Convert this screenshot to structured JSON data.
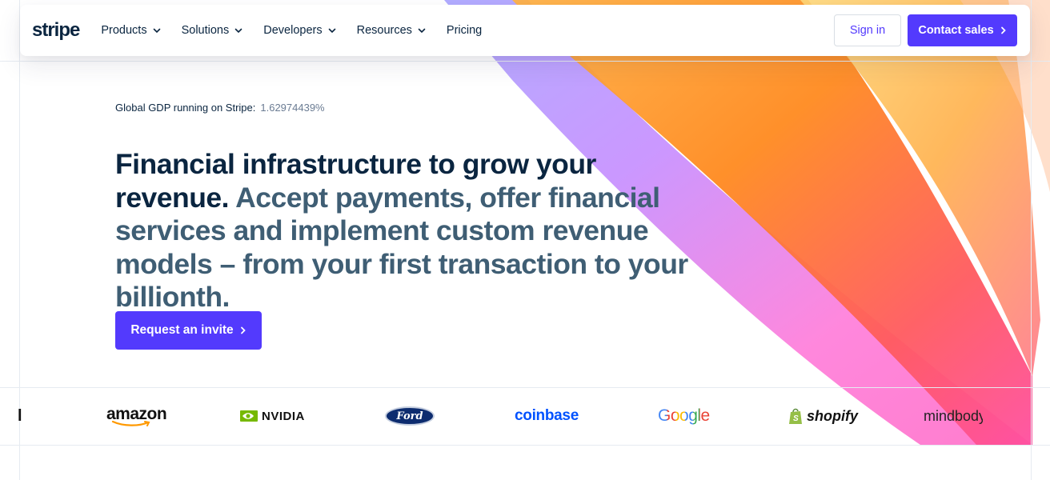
{
  "nav": {
    "logo": "stripe",
    "items": [
      {
        "label": "Products",
        "has_menu": true
      },
      {
        "label": "Solutions",
        "has_menu": true
      },
      {
        "label": "Developers",
        "has_menu": true
      },
      {
        "label": "Resources",
        "has_menu": true
      },
      {
        "label": "Pricing",
        "has_menu": false
      }
    ],
    "sign_in": "Sign in",
    "contact_sales": "Contact sales"
  },
  "hero": {
    "gdp_label": "Global GDP running on Stripe:",
    "gdp_value": "1.62974439%",
    "headline_main": "Financial infrastructure to grow your revenue.",
    "headline_sub": "Accept payments, offer financial services and implement custom revenue models – from your first transaction to your billionth.",
    "cta": "Request an invite"
  },
  "logos": {
    "cut_left": "l",
    "amazon": "amazon",
    "nvidia": "NVIDIA",
    "ford": "Ford",
    "coinbase": "coinbase",
    "google": "Google",
    "shopify": "shopify",
    "mindbody": "mindbody"
  },
  "colors": {
    "accent": "#533afd",
    "heading": "#0a2540",
    "subheading": "#3f5e74"
  }
}
